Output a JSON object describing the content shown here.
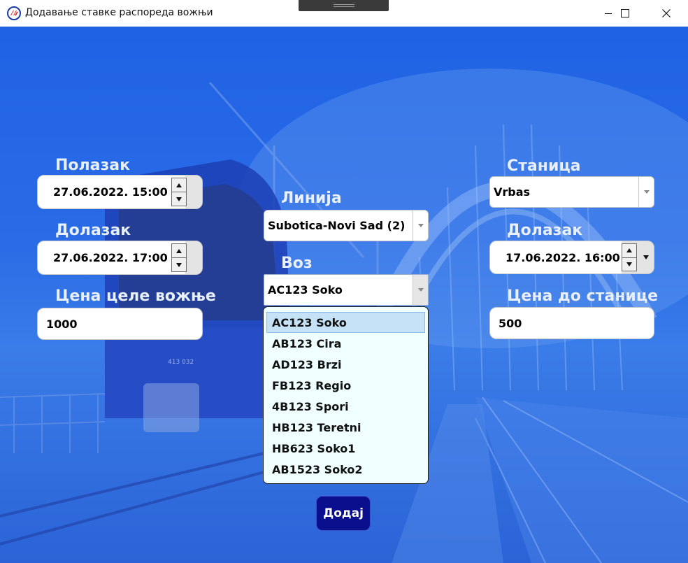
{
  "window": {
    "title": "Додавање ставке распореда вожњи",
    "logo_icon": "serbian-railways-logo",
    "controls": [
      "minimize",
      "maximize",
      "close"
    ]
  },
  "left": {
    "departure_label": "Полазак",
    "departure_value": "27.06.2022. 15:00",
    "arrival_label": "Долазак",
    "arrival_value": "27.06.2022. 17:00",
    "price_label": "Цена целе вожње",
    "price_value": "1000"
  },
  "center": {
    "line_label": "Линија",
    "line_value": "Subotica-Novi Sad (2)",
    "train_label": "Воз",
    "train_value": "AC123 Soko",
    "train_options": [
      "AC123 Soko",
      "AB123 Cira",
      "AD123 Brzi",
      "FB123 Regio",
      "4B123 Spori",
      "HB123 Teretni",
      "HB623 Soko1",
      "AB1523 Soko2"
    ],
    "selected_index": 0,
    "add_button_label": "Додај"
  },
  "right": {
    "station_label": "Станица",
    "station_value": "Vrbas",
    "arrival_label": "Долазак",
    "arrival_value": "17.06.2022. 16:00",
    "price_label": "Цена до станице",
    "price_value": "500"
  },
  "colors": {
    "background": "#2a6be6",
    "label_text": "#e8f0ff",
    "add_button": "#0a0f8e",
    "list_background": "#f0ffff",
    "list_selected": "#c5e2f7"
  }
}
